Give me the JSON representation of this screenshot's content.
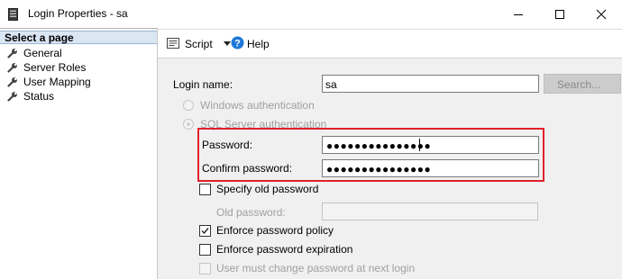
{
  "window": {
    "title": "Login Properties - sa",
    "icon": "server-icon"
  },
  "sidebar": {
    "header": "Select a page",
    "items": [
      {
        "label": "General",
        "icon": "wrench-icon"
      },
      {
        "label": "Server Roles",
        "icon": "wrench-icon"
      },
      {
        "label": "User Mapping",
        "icon": "wrench-icon"
      },
      {
        "label": "Status",
        "icon": "wrench-icon"
      }
    ]
  },
  "toolbar": {
    "script_label": "Script",
    "help_label": "Help"
  },
  "form": {
    "login_name_label": "Login name:",
    "login_name_value": "sa",
    "search_button": "Search...",
    "windows_auth_label": "Windows authentication",
    "sql_auth_label": "SQL Server authentication",
    "sql_auth_selected": true,
    "password_label": "Password:",
    "password_value": "●●●●●●●●●●●●●●●",
    "confirm_password_label": "Confirm password:",
    "confirm_password_value": "●●●●●●●●●●●●●●●",
    "specify_old_password_label": "Specify old password",
    "specify_old_password_checked": false,
    "old_password_label": "Old password:",
    "enforce_policy_label": "Enforce password policy",
    "enforce_policy_checked": true,
    "enforce_expiration_label": "Enforce password expiration",
    "enforce_expiration_checked": false,
    "must_change_label": "User must change password at next login",
    "must_change_checked": false
  },
  "colors": {
    "highlight_border": "#e2202a",
    "header_bg": "#dbe6f4",
    "content_bg": "#f0f0f0",
    "help_icon": "#1e78d7"
  }
}
